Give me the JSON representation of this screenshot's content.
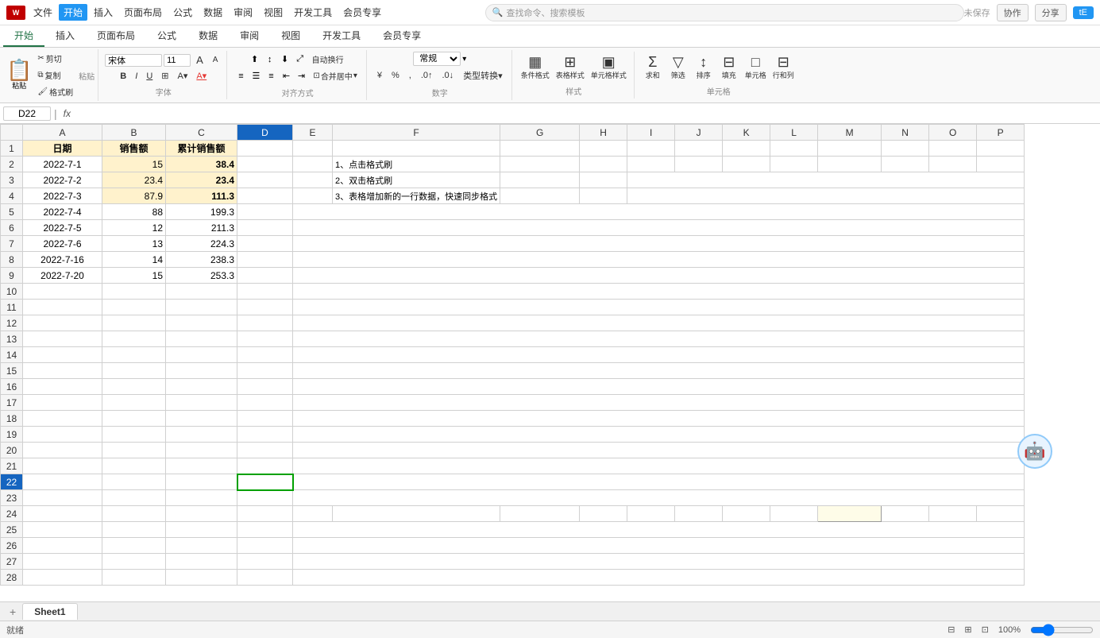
{
  "titlebar": {
    "logo": "W",
    "menus": [
      "文件",
      "开始",
      "插入",
      "页面布局",
      "公式",
      "数据",
      "审阅",
      "视图",
      "开发工具",
      "会员专享"
    ],
    "active_menu": "开始",
    "filename": "",
    "search_placeholder": "查找命令、搜索模板",
    "unsaved": "未保存",
    "collab": "协作",
    "share": "分享",
    "user_initials": "tE"
  },
  "ribbon": {
    "tabs": [
      "开始",
      "插入",
      "页面布局",
      "公式",
      "数据",
      "审阅",
      "视图",
      "开发工具",
      "会员专享"
    ],
    "active_tab": "开始",
    "clipboard": {
      "paste_label": "粘贴",
      "cut_label": "剪切",
      "copy_label": "复制",
      "format_label": "格式刷"
    },
    "font": {
      "name": "宋体",
      "size": "11"
    },
    "alignment": {
      "merge_label": "合并居中",
      "wrap_label": "自动换行"
    },
    "number": {
      "format": "常规",
      "percent_label": "%",
      "comma_label": ",",
      "decimal_inc": ".0",
      "decimal_dec": ".00"
    },
    "styles": {
      "conditional_label": "条件格式",
      "table_format_label": "表格样式",
      "cell_style_label": "单元格样式"
    },
    "cells_group": {
      "sum_label": "求和",
      "filter_label": "筛选",
      "sort_label": "排序",
      "fill_label": "填充",
      "clear_label": "单元格",
      "row_col_label": "行和列"
    }
  },
  "formula_bar": {
    "cell_ref": "D22",
    "formula": "",
    "fx": "fx"
  },
  "columns": [
    "A",
    "B",
    "C",
    "D",
    "E",
    "F",
    "G",
    "H",
    "I",
    "J",
    "K",
    "L",
    "M",
    "N",
    "O",
    "P"
  ],
  "rows_count": 28,
  "data": {
    "headers": {
      "A": "日期",
      "B": "销售额",
      "C": "累计销售额"
    },
    "rows": [
      {
        "row": 2,
        "A": "2022-7-1",
        "B": "15",
        "C": "38.4"
      },
      {
        "row": 3,
        "A": "2022-7-2",
        "B": "23.4",
        "C": "23.4"
      },
      {
        "row": 4,
        "A": "2022-7-3",
        "B": "87.9",
        "C": "111.3"
      },
      {
        "row": 5,
        "A": "2022-7-4",
        "B": "88",
        "C": "199.3"
      },
      {
        "row": 6,
        "A": "2022-7-5",
        "B": "12",
        "C": "211.3"
      },
      {
        "row": 7,
        "A": "2022-7-6",
        "B": "13",
        "C": "224.3"
      },
      {
        "row": 8,
        "A": "2022-7-16",
        "B": "14",
        "C": "238.3"
      },
      {
        "row": 9,
        "A": "2022-7-20",
        "B": "15",
        "C": "253.3"
      }
    ],
    "instructions": {
      "f1": "1、点击格式刷",
      "f2": "2、双击格式刷",
      "f3": "3、表格增加新的一行数据，快速同步格式"
    }
  },
  "active_cell": "D22",
  "sheet_tabs": [
    "Sheet1"
  ],
  "active_sheet": "Sheet1",
  "status": {
    "zoom": "100%",
    "mode": "就绪"
  }
}
